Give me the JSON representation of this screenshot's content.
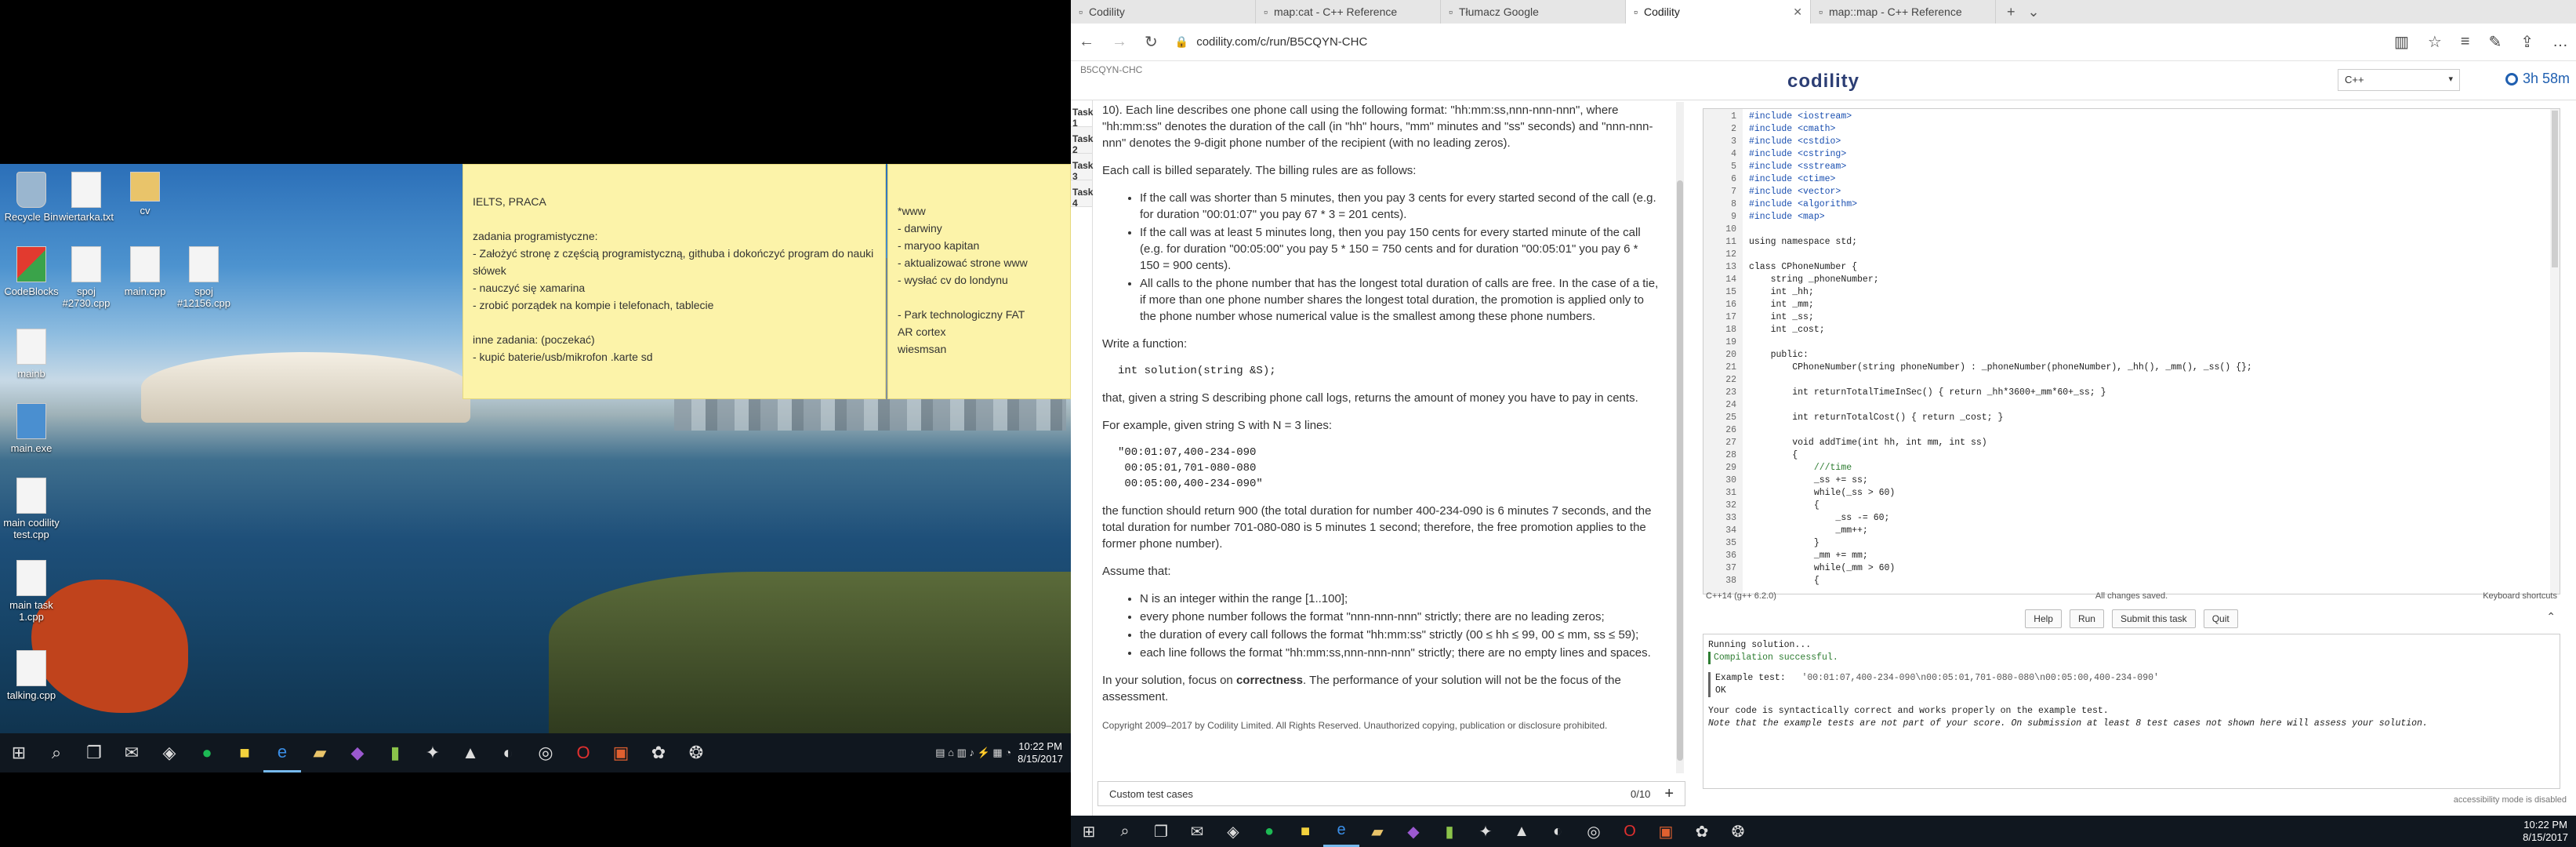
{
  "desktop": {
    "icons": [
      {
        "label": "Recycle Bin",
        "kind": "bin"
      },
      {
        "label": "wiertarka.txt",
        "kind": "file"
      },
      {
        "label": "cv",
        "kind": "folder"
      },
      {
        "label": "CodeBlocks",
        "kind": "cb"
      },
      {
        "label": "spoj #2730.cpp",
        "kind": "file"
      },
      {
        "label": "main.cpp",
        "kind": "file"
      },
      {
        "label": "spoj #12156.cpp",
        "kind": "file"
      },
      {
        "label": "mainb",
        "kind": "file"
      },
      {
        "label": "main.exe",
        "kind": "exe"
      },
      {
        "label": "main codility test.cpp",
        "kind": "file"
      },
      {
        "label": "main task 1.cpp",
        "kind": "file"
      },
      {
        "label": "talking.cpp",
        "kind": "file"
      }
    ],
    "note1": [
      "IELTS, PRACA",
      "",
      "zadania programistyczne:",
      "- Założyć stronę z częścią programistyczną, githuba i dokończyć program do nauki słówek",
      "- nauczyć się xamarina",
      "- zrobić porządek na kompie i telefonach, tablecie",
      "",
      "inne zadania: (poczekać)",
      "- kupić baterie/usb/mikrofon .karte sd"
    ],
    "note2": [
      "*www",
      "- darwiny",
      "- maryoo kapitan",
      "- aktualizować strone www",
      "- wysłać cv do londynu",
      "",
      "- Park technologiczny FAT",
      "AR cortex",
      "wiesmsan"
    ]
  },
  "taskbar_left": {
    "time": "10:22 PM",
    "date": "8/15/2017"
  },
  "taskbar_right": {
    "time": "10:22 PM",
    "date": "8/15/2017"
  },
  "browser": {
    "tabs": [
      {
        "title": "Codility",
        "active": false
      },
      {
        "title": "map:cat - C++ Reference",
        "active": false
      },
      {
        "title": "Tłumacz Google",
        "active": false
      },
      {
        "title": "Codility",
        "active": true
      },
      {
        "title": "map::map - C++ Reference",
        "active": false
      }
    ],
    "url": "codility.com/c/run/B5CQYN-CHC"
  },
  "codility": {
    "task_id": "B5CQYN-CHC",
    "brand": "codility",
    "language": "C++",
    "timer": "3h 58m",
    "task_tabs": [
      "Task 1",
      "Task 2",
      "Task 3",
      "Task 4"
    ],
    "description": {
      "p1": "10). Each line describes one phone call using the following format: \"hh:mm:ss,nnn-nnn-nnn\", where \"hh:mm:ss\" denotes the duration of the call (in \"hh\" hours, \"mm\" minutes and \"ss\" seconds) and \"nnn-nnn-nnn\" denotes the 9-digit phone number of the recipient (with no leading zeros).",
      "p2": "Each call is billed separately. The billing rules are as follows:",
      "rules": [
        "If the call was shorter than 5 minutes, then you pay 3 cents for every started second of the call (e.g. for duration \"00:01:07\" you pay 67 * 3 = 201 cents).",
        "If the call was at least 5 minutes long, then you pay 150 cents for every started minute of the call (e.g. for duration \"00:05:00\" you pay 5 * 150 = 750 cents and for duration \"00:05:01\" you pay 6 * 150 = 900 cents).",
        "All calls to the phone number that has the longest total duration of calls are free. In the case of a tie, if more than one phone number shares the longest total duration, the promotion is applied only to the phone number whose numerical value is the smallest among these phone numbers."
      ],
      "write_fn": "Write a function:",
      "signature": "int solution(string &S);",
      "p3": "that, given a string S describing phone call logs, returns the amount of money you have to pay in cents.",
      "p4": "For example, given string S with N = 3 lines:",
      "example": "\"00:01:07,400-234-090\n 00:05:01,701-080-080\n 00:05:00,400-234-090\"",
      "p5": "the function should return 900 (the total duration for number 400-234-090 is 6 minutes 7 seconds, and the total duration for number 701-080-080 is 5 minutes 1 second; therefore, the free promotion applies to the former phone number).",
      "assume": "Assume that:",
      "assumptions": [
        "N is an integer within the range [1..100];",
        "every phone number follows the format \"nnn-nnn-nnn\" strictly; there are no leading zeros;",
        "the duration of every call follows the format \"hh:mm:ss\" strictly (00 ≤ hh ≤ 99, 00 ≤ mm, ss ≤ 59);",
        "each line follows the format \"hh:mm:ss,nnn-nnn-nnn\" strictly; there are no empty lines and spaces."
      ],
      "focus_prefix": "In your solution, focus on ",
      "focus_bold": "correctness",
      "focus_suffix": ". The performance of your solution will not be the focus of the assessment.",
      "copyright": "Copyright 2009–2017 by Codility Limited. All Rights Reserved. Unauthorized copying, publication or disclosure prohibited."
    },
    "custom_tests": {
      "label": "Custom test cases",
      "count": "0/10",
      "add": "+"
    },
    "code_lines": [
      "#include <iostream>",
      "#include <cmath>",
      "#include <cstdio>",
      "#include <cstring>",
      "#include <sstream>",
      "#include <ctime>",
      "#include <vector>",
      "#include <algorithm>",
      "#include <map>",
      "",
      "using namespace std;",
      "",
      "class CPhoneNumber {",
      "    string _phoneNumber;",
      "    int _hh;",
      "    int _mm;",
      "    int _ss;",
      "    int _cost;",
      "",
      "    public:",
      "        CPhoneNumber(string phoneNumber) : _phoneNumber(phoneNumber), _hh(), _mm(), _ss() {};",
      "",
      "        int returnTotalTimeInSec() { return _hh*3600+_mm*60+_ss; }",
      "",
      "        int returnTotalCost() { return _cost; }",
      "",
      "        void addTime(int hh, int mm, int ss)",
      "        {",
      "            ///time",
      "            _ss += ss;",
      "            while(_ss > 60)",
      "            {",
      "                _ss -= 60;",
      "                _mm++;",
      "            }",
      "            _mm += mm;",
      "            while(_mm > 60)",
      "            {"
    ],
    "status": {
      "compiler": "C++14 (g++ 6.2.0)",
      "saved": "All changes saved.",
      "shortcuts": "Keyboard shortcuts"
    },
    "buttons": {
      "help": "Help",
      "run": "Run",
      "submit": "Submit this task",
      "quit": "Quit"
    },
    "console": {
      "running": "Running solution...",
      "compiled": "Compilation successful.",
      "example_label": "Example test:",
      "example_input": "'00:01:07,400-234-090\\n00:05:01,701-080-080\\n00:05:00,400-234-090'",
      "example_result": "OK",
      "summary": "Your code is syntactically correct and works properly on the example test.",
      "note": "Note that the example tests are not part of your score. On submission at least 8 test cases not shown here will assess your solution."
    },
    "accessibility": "accessibility mode is disabled"
  }
}
